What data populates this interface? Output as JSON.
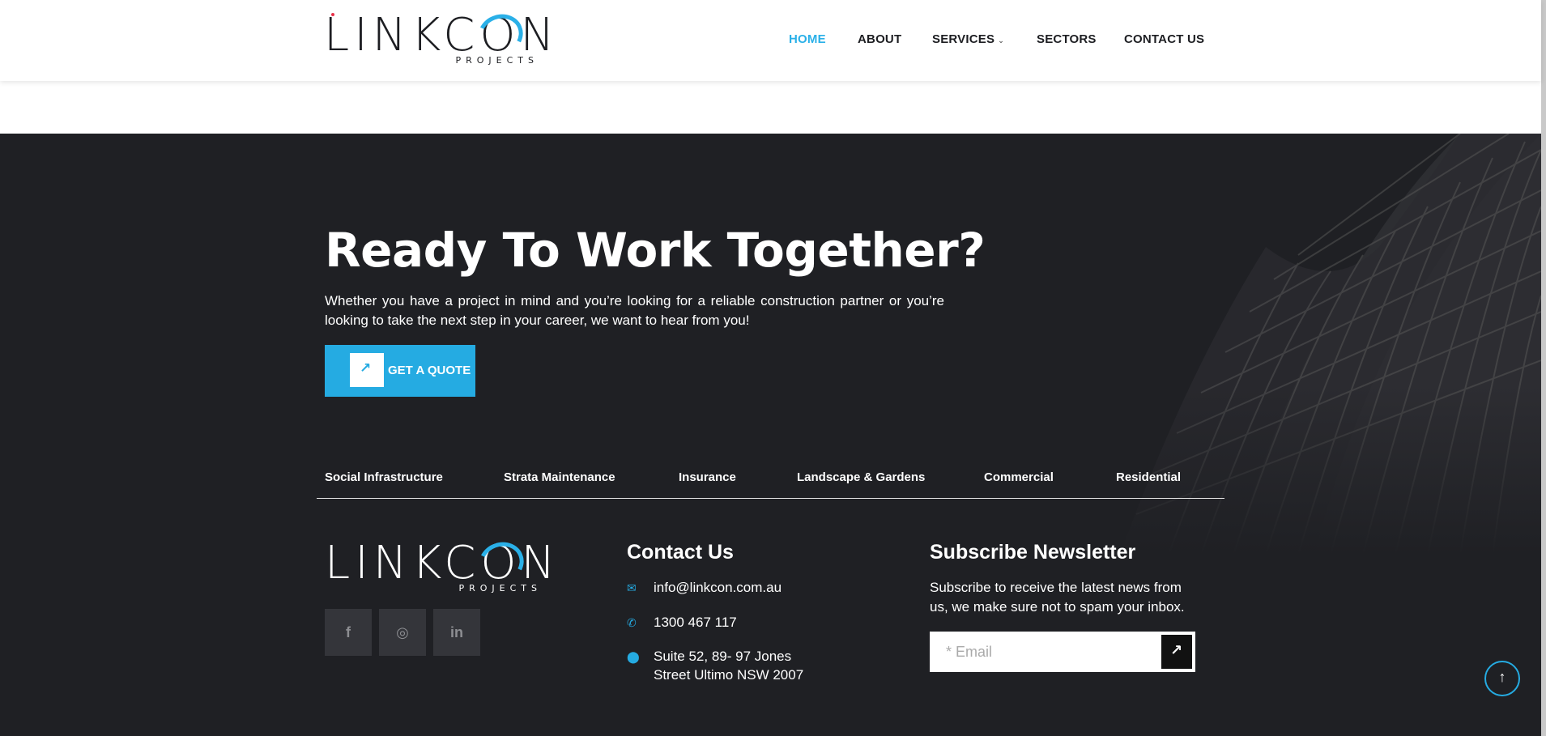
{
  "brand": {
    "name": "LINKCON",
    "tagline": "PROJECTS",
    "accent": "#25abe2",
    "dark_bg": "#1f2024"
  },
  "nav": {
    "items": [
      {
        "label": "HOME",
        "active": true
      },
      {
        "label": "ABOUT",
        "active": false
      },
      {
        "label": "SERVICES",
        "active": false,
        "has_dropdown": true
      },
      {
        "label": "SECTORS",
        "active": false
      },
      {
        "label": "CONTACT US",
        "active": false
      }
    ]
  },
  "cta": {
    "title": "Ready To Work Together?",
    "text": "Whether you have a project in mind and you’re looking for a reliable construction partner or you’re looking to take the next step in your career, we want to hear from you!",
    "button_label": "GET A QUOTE",
    "button_icon": "arrow-up-right-icon"
  },
  "sectors": [
    "Social Infrastructure",
    "Strata Maintenance",
    "Insurance",
    "Landscape & Gardens",
    "Commercial",
    "Residential"
  ],
  "footer": {
    "social": [
      {
        "name": "facebook-icon",
        "glyph": "f"
      },
      {
        "name": "instagram-icon",
        "glyph": "◎"
      },
      {
        "name": "linkedin-icon",
        "glyph": "in"
      }
    ],
    "contact": {
      "title": "Contact Us",
      "email": "info@linkcon.com.au",
      "phone": "1300 467 117",
      "address_line1": "Suite 52, 89- 97 Jones",
      "address_line2": "Street Ultimo NSW 2007"
    },
    "newsletter": {
      "title": "Subscribe Newsletter",
      "text": "Subscribe to receive the latest news from us, we make sure not to spam your inbox.",
      "placeholder": "* Email"
    }
  }
}
